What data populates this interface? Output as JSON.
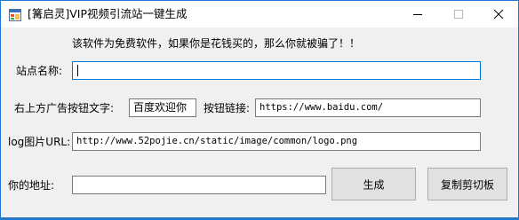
{
  "window": {
    "title": "[篝启灵]VIP视频引流站一键生成",
    "icon": "app-form-icon"
  },
  "title_controls": [
    "minimize-icon",
    "maximize-icon",
    "close-icon"
  ],
  "notice": "该软件为免费软件，如果你是花钱买的，那么你就被骗了！！",
  "site_name": {
    "label": "站点名称:",
    "value": ""
  },
  "ad_button": {
    "label": "右上方广告按钮文字:",
    "value": "百度欢迎你"
  },
  "button_link": {
    "label": "按钮链接:",
    "value": "https://www.baidu.com/"
  },
  "logo_url": {
    "label": "log图片URL:",
    "value": "http://www.52pojie.cn/static/image/common/logo.png"
  },
  "your_address": {
    "label": "你的地址:",
    "value": ""
  },
  "buttons": {
    "generate": "生成",
    "copy": "复制剪切板"
  },
  "colors": {
    "accent": "#0078d7",
    "window_bg": "#f0f0f0",
    "button_bg": "#e1e1e1"
  }
}
